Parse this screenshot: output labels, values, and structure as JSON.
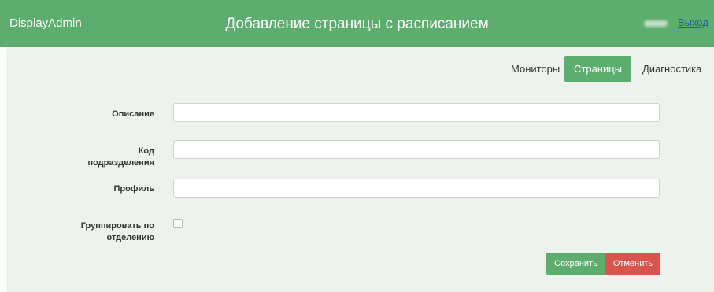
{
  "header": {
    "brand": "DisplayAdmin",
    "title": "Добавление страницы с расписанием",
    "logout": "Выход"
  },
  "nav": {
    "items": [
      "Мониторы",
      "Страницы",
      "Диагностика"
    ],
    "active": "Страницы"
  },
  "form": {
    "description_label": "Описание",
    "division_code_label_line1": "Код",
    "division_code_label_line2": "подразделения",
    "profile_label": "Профиль",
    "group_label_line1": "Группировать по",
    "group_label_line2": "отделению",
    "description_value": "",
    "division_code_value": "",
    "profile_value": "",
    "group_checked": false
  },
  "buttons": {
    "save": "Сохранить",
    "cancel": "Отменить"
  },
  "colors": {
    "header_green": "#5cad6e",
    "panel_bg": "#eef2ec",
    "cancel_red": "#d9534f"
  }
}
